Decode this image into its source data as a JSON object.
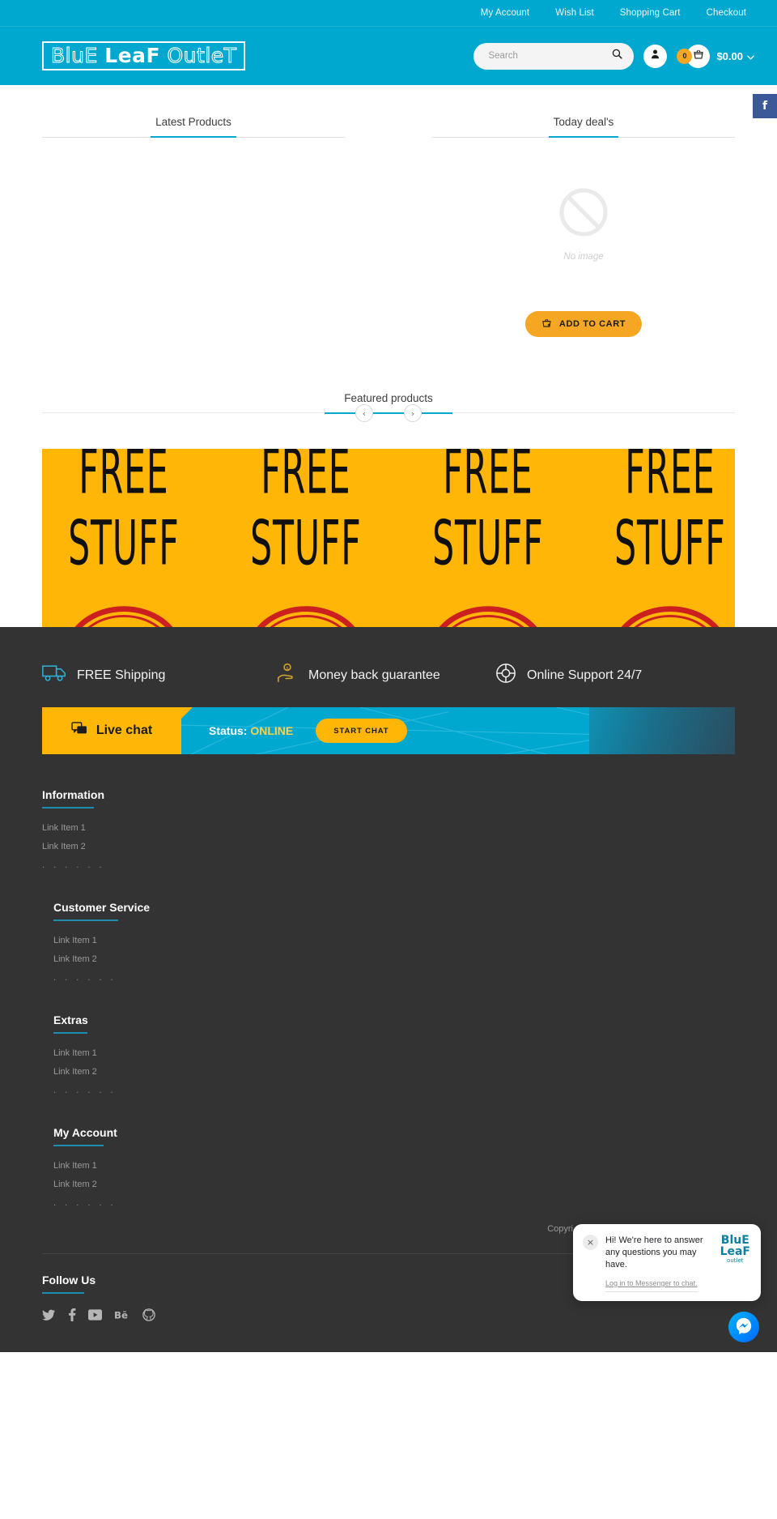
{
  "header": {
    "topnav": [
      "My Account",
      "Wish List",
      "Shopping Cart",
      "Checkout"
    ],
    "logo": {
      "part1": "BluE",
      "part2": "LeaF",
      "part3": "OutleT"
    },
    "search": {
      "placeholder": "Search",
      "value": ""
    },
    "cart": {
      "count": "0",
      "total": "$0.00"
    },
    "accent_color": "#00a8d0"
  },
  "side_tab": {
    "label": "f",
    "color": "#3b5998"
  },
  "tabs": {
    "left": {
      "label": "Latest Products"
    },
    "right": {
      "label": "Today deal's"
    }
  },
  "product": {
    "no_image_label": "No image",
    "add_to_cart_label": "ADD TO CART",
    "button_color": "#f5a623"
  },
  "featured": {
    "title": "Featured products",
    "prev": "‹",
    "next": "›"
  },
  "banner": {
    "line1": "FREE",
    "line2": "STUFF",
    "bg_color": "#ffb606",
    "stamp_color": "#cc1f1f"
  },
  "features": [
    {
      "icon": "truck-icon",
      "label": "FREE Shipping",
      "color": "#2fb3d6"
    },
    {
      "icon": "hand-coin-icon",
      "label": "Money back guarantee",
      "color": "#d0a22e"
    },
    {
      "icon": "lifebuoy-icon",
      "label": "Online Support 24/7",
      "color": "#f0f0f0"
    }
  ],
  "live_chat": {
    "title": "Live chat",
    "status_label": "Status:",
    "status_value": "ONLINE",
    "button_label": "START CHAT"
  },
  "footer_columns": [
    {
      "title": "Information",
      "links": [
        "Link Item 1",
        "Link Item 2"
      ],
      "dots": ". . . . . ."
    },
    {
      "title": "Customer Service",
      "links": [
        "Link Item 1",
        "Link Item 2"
      ],
      "dots": ". . . . . ."
    },
    {
      "title": "Extras",
      "links": [
        "Link Item 1",
        "Link Item 2"
      ],
      "dots": ". . . . . ."
    },
    {
      "title": "My Account",
      "links": [
        "Link Item 1",
        "Link Item 2"
      ],
      "dots": ". . . . . ."
    }
  ],
  "copyright": "Copyri",
  "follow": {
    "title": "Follow Us",
    "icons": [
      "twitter-icon",
      "facebook-icon",
      "youtube-icon",
      "behance-icon",
      "github-icon"
    ],
    "glyphs": [
      "ᵛ",
      "f",
      "▶",
      "Bē",
      "○"
    ]
  },
  "messenger": {
    "close": "×",
    "message": "Hi! We're here to answer any questions you may have.",
    "login_link": "Log in to Messenger to chat.",
    "logo": {
      "l1": "BluE",
      "l2": "LeaF",
      "l3": "outlet"
    }
  }
}
